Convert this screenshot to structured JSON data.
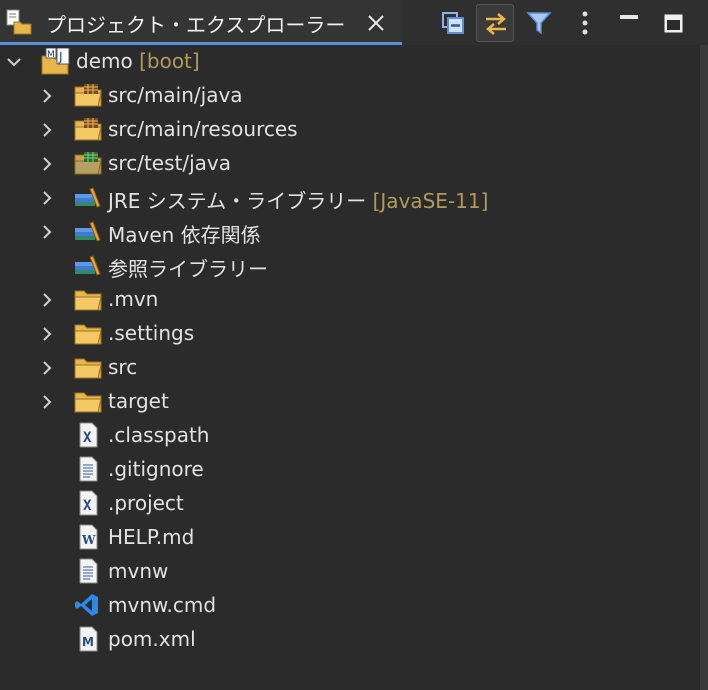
{
  "view": {
    "title": "プロジェクト・エクスプローラー",
    "close_icon": "close-icon",
    "toolbar": [
      {
        "name": "collapse-all-button",
        "icon": "collapse-all-icon"
      },
      {
        "name": "link-with-editor-button",
        "icon": "link-with-editor-icon",
        "active": true
      },
      {
        "name": "filter-button",
        "icon": "filter-icon"
      },
      {
        "name": "view-menu-button",
        "icon": "kebab-menu-icon"
      },
      {
        "name": "minimize-button",
        "icon": "minimize-icon"
      },
      {
        "name": "maximize-button",
        "icon": "maximize-icon"
      }
    ]
  },
  "tree": {
    "project": {
      "label": "demo",
      "decoration": "[boot]",
      "expanded": true,
      "icon": "maven-project-icon"
    },
    "items": [
      {
        "label": "src/main/java",
        "decoration": "",
        "icon": "source-folder-icon",
        "expandable": true
      },
      {
        "label": "src/main/resources",
        "decoration": "",
        "icon": "source-folder-icon",
        "expandable": true
      },
      {
        "label": "src/test/java",
        "decoration": "",
        "icon": "test-source-folder-icon",
        "expandable": true
      },
      {
        "label": "JRE システム・ライブラリー",
        "decoration": "[JavaSE-11]",
        "icon": "library-icon",
        "expandable": true
      },
      {
        "label": "Maven 依存関係",
        "decoration": "",
        "icon": "library-icon",
        "expandable": true
      },
      {
        "label": "参照ライブラリー",
        "decoration": "",
        "icon": "library-icon",
        "expandable": false
      },
      {
        "label": ".mvn",
        "decoration": "",
        "icon": "folder-icon",
        "expandable": true
      },
      {
        "label": ".settings",
        "decoration": "",
        "icon": "folder-icon",
        "expandable": true
      },
      {
        "label": "src",
        "decoration": "",
        "icon": "folder-icon",
        "expandable": true
      },
      {
        "label": "target",
        "decoration": "",
        "icon": "folder-icon",
        "expandable": true
      },
      {
        "label": ".classpath",
        "decoration": "",
        "icon": "xml-file-icon",
        "expandable": false
      },
      {
        "label": ".gitignore",
        "decoration": "",
        "icon": "text-file-icon",
        "expandable": false
      },
      {
        "label": ".project",
        "decoration": "",
        "icon": "xml-file-icon",
        "expandable": false
      },
      {
        "label": "HELP.md",
        "decoration": "",
        "icon": "markdown-file-icon",
        "expandable": false
      },
      {
        "label": "mvnw",
        "decoration": "",
        "icon": "text-file-icon",
        "expandable": false
      },
      {
        "label": "mvnw.cmd",
        "decoration": "",
        "icon": "vscode-file-icon",
        "expandable": false
      },
      {
        "label": "pom.xml",
        "decoration": "",
        "icon": "maven-pom-icon",
        "expandable": false
      }
    ]
  },
  "colors": {
    "background": "#2b2b2b",
    "active_tab_underline": "#5b8ed6",
    "decoration_text": "#b09a5c",
    "folder_yellow": "#e8b64a"
  }
}
